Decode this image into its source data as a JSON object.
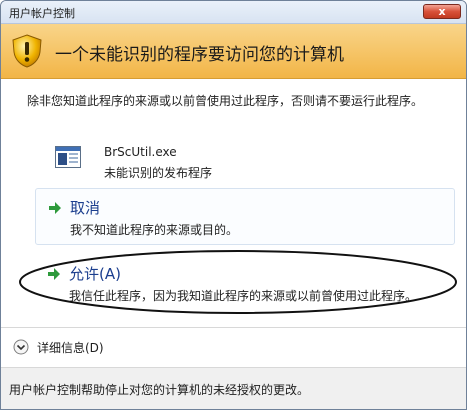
{
  "window": {
    "title": "用户帐户控制",
    "close_label": "x"
  },
  "banner": {
    "icon": "shield-warning-icon",
    "title": "一个未能识别的程序要访问您的计算机"
  },
  "warning_text": "除非您知道此程序的来源或以前曾使用过此程序，否则请不要运行此程序。",
  "program": {
    "icon": "application-icon",
    "name": "BrScUtil.exe",
    "publisher": "未能识别的发布程序"
  },
  "options": {
    "cancel": {
      "title": "取消",
      "description": "我不知道此程序的来源或目的。"
    },
    "allow": {
      "title": "允许(A)",
      "description": "我信任此程序，因为我知道此程序的来源或以前曾使用过此程序。"
    }
  },
  "details": {
    "icon": "chevron-down-icon",
    "label": "详细信息(D)"
  },
  "footer": {
    "text": "用户帐户控制帮助停止对您的计算机的未经授权的更改。"
  },
  "colors": {
    "banner": "#f2b547",
    "option_title": "#1b3e8e",
    "arrow": "#2e9a3c",
    "close_button": "#d8513a"
  }
}
